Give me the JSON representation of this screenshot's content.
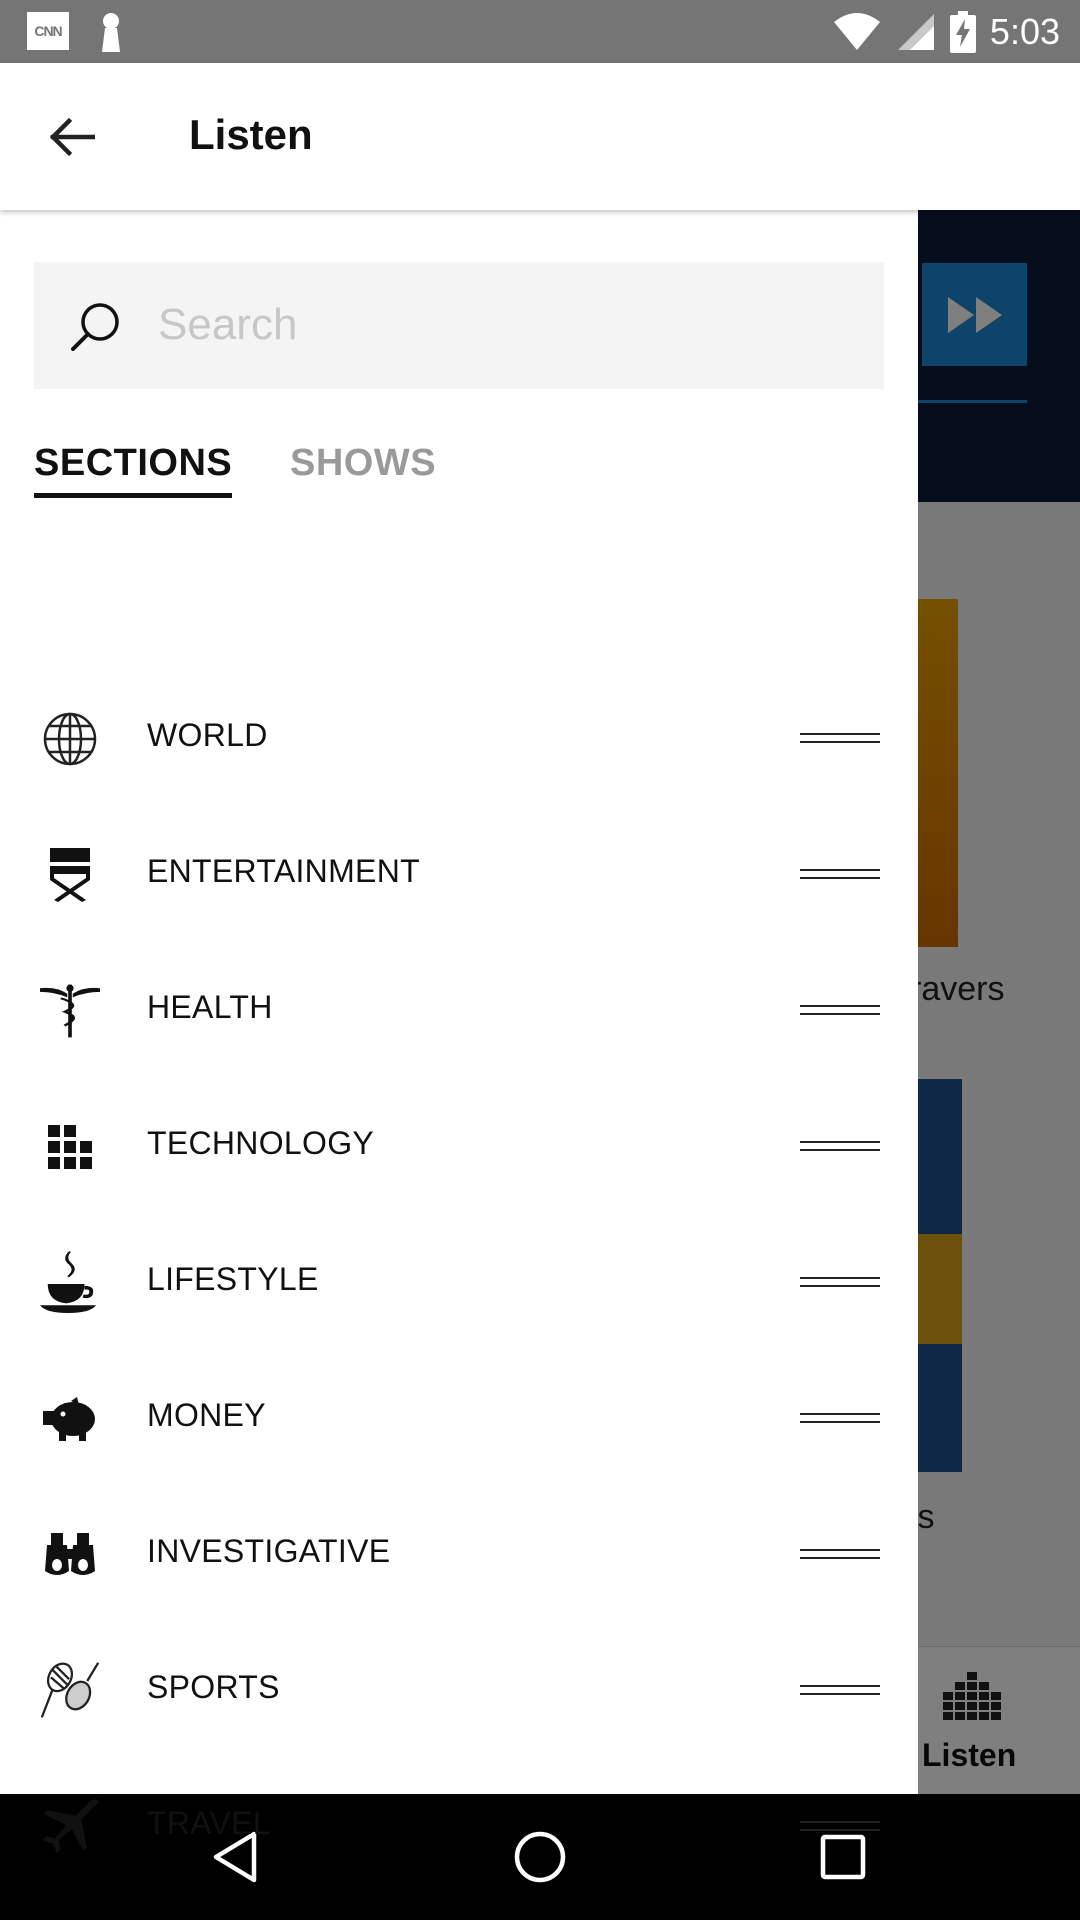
{
  "status_bar": {
    "time": "5:03",
    "left_icons": [
      "cnn-notification-icon",
      "keyhole-icon"
    ],
    "right_icons": [
      "wifi-icon",
      "cell-signal-icon",
      "battery-charging-icon"
    ],
    "cnn_label": "CNN"
  },
  "app_bar": {
    "title": "Listen",
    "back_icon": "arrow-left-icon"
  },
  "drawer": {
    "search": {
      "placeholder": "Search",
      "value": ""
    },
    "tabs": [
      {
        "label": "SECTIONS",
        "active": true
      },
      {
        "label": "SHOWS",
        "active": false
      }
    ],
    "sections": [
      {
        "label": "WORLD",
        "icon": "globe-icon"
      },
      {
        "label": "ENTERTAINMENT",
        "icon": "directors-chair-icon"
      },
      {
        "label": "HEALTH",
        "icon": "caduceus-icon"
      },
      {
        "label": "TECHNOLOGY",
        "icon": "grid-icon"
      },
      {
        "label": "LIFESTYLE",
        "icon": "coffee-cup-icon"
      },
      {
        "label": "MONEY",
        "icon": "piggy-bank-icon"
      },
      {
        "label": "INVESTIGATIVE",
        "icon": "binoculars-icon"
      },
      {
        "label": "SPORTS",
        "icon": "tennis-rackets-icon"
      },
      {
        "label": "TRAVEL",
        "icon": "airplane-icon"
      }
    ]
  },
  "background": {
    "card_text_1": "ravers",
    "card_text_2": "is",
    "bottom_nav_label": "Listen",
    "accent_color": "#1d88d2"
  },
  "nav_bar": {
    "buttons": [
      "back-triangle-icon",
      "home-circle-icon",
      "recents-square-icon"
    ]
  }
}
